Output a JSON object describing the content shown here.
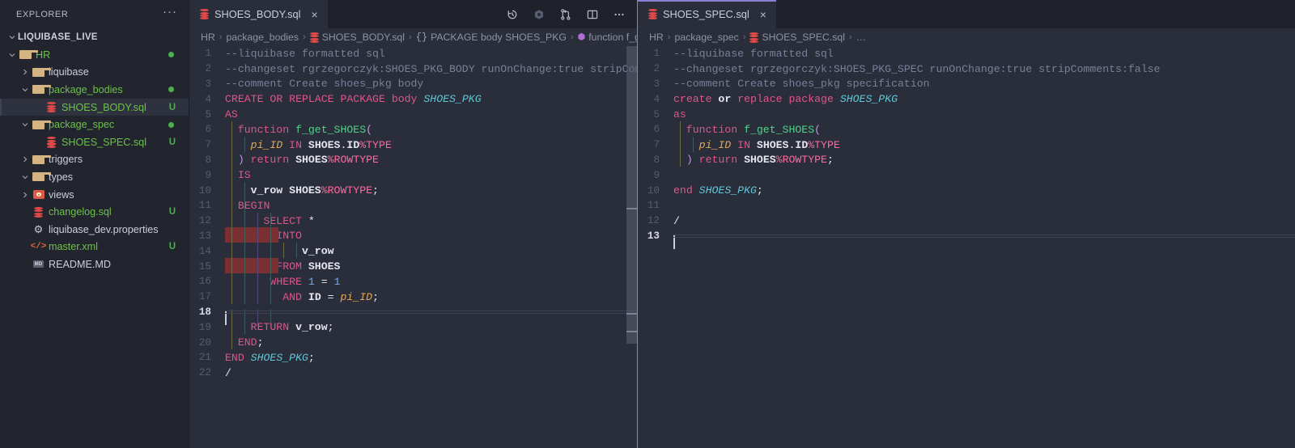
{
  "sidebar": {
    "title": "EXPLORER",
    "more_label": "···",
    "root": "LIQUIBASE_LIVE",
    "items": [
      {
        "label": "HR",
        "icon": "folder-icon",
        "indent": 1,
        "arrow": "down",
        "color": "green",
        "status": "dot",
        "selected": false
      },
      {
        "label": "liquibase",
        "icon": "folder-icon",
        "indent": 2,
        "arrow": "right",
        "color": "plain",
        "status": "",
        "selected": false
      },
      {
        "label": "package_bodies",
        "icon": "folder-icon",
        "indent": 2,
        "arrow": "down",
        "color": "green",
        "status": "dot",
        "selected": false
      },
      {
        "label": "SHOES_BODY.sql",
        "icon": "database-icon",
        "indent": 3,
        "arrow": "none",
        "color": "green",
        "status": "U",
        "selected": true
      },
      {
        "label": "package_spec",
        "icon": "folder-icon",
        "indent": 2,
        "arrow": "down",
        "color": "green",
        "status": "dot",
        "selected": false
      },
      {
        "label": "SHOES_SPEC.sql",
        "icon": "database-icon",
        "indent": 3,
        "arrow": "none",
        "color": "green",
        "status": "U",
        "selected": false
      },
      {
        "label": "triggers",
        "icon": "folder-icon",
        "indent": 2,
        "arrow": "right",
        "color": "plain",
        "status": "",
        "selected": false
      },
      {
        "label": "types",
        "icon": "folder-icon",
        "indent": 2,
        "arrow": "down",
        "color": "plain",
        "status": "",
        "selected": false
      },
      {
        "label": "views",
        "icon": "views-icon",
        "indent": 2,
        "arrow": "right",
        "color": "plain",
        "status": "",
        "selected": false
      },
      {
        "label": "changelog.sql",
        "icon": "database-icon",
        "indent": 2,
        "arrow": "none",
        "color": "green",
        "status": "U",
        "selected": false
      },
      {
        "label": "liquibase_dev.properties",
        "icon": "gear-icon",
        "indent": 2,
        "arrow": "none",
        "color": "plain",
        "status": "",
        "selected": false
      },
      {
        "label": "master.xml",
        "icon": "xml-icon",
        "indent": 2,
        "arrow": "none",
        "color": "green",
        "status": "U",
        "selected": false
      },
      {
        "label": "README.MD",
        "icon": "markdown-icon",
        "indent": 2,
        "arrow": "none",
        "color": "plain",
        "status": "",
        "selected": false
      }
    ]
  },
  "colors": {
    "accent_purple": "#8a7fd4",
    "git_modified_green": "#4caf50",
    "file_green": "#6cc24a",
    "db_icon_red": "#e24a4a",
    "folder_tan": "#d4b483",
    "editor_bg": "#2a2d3a",
    "sidebar_bg": "#22242e",
    "tabbar_bg": "#1f212b",
    "error_bar_red": "#7a2f33"
  },
  "editor_left": {
    "tab": {
      "label": "SHOES_BODY.sql",
      "icon": "database-icon",
      "close": "×",
      "active": false
    },
    "toolbar": [
      {
        "name": "history-icon",
        "title": "Timeline / History"
      },
      {
        "name": "refresh-icon",
        "title": "Refresh"
      },
      {
        "name": "source-control-icon",
        "title": "Source Control"
      },
      {
        "name": "split-editor-icon",
        "title": "Split Editor"
      },
      {
        "name": "more-actions-icon",
        "title": "More Actions…"
      }
    ],
    "breadcrumb": [
      {
        "label": "HR",
        "icon": "none"
      },
      {
        "label": "package_bodies",
        "icon": "none"
      },
      {
        "label": "SHOES_BODY.sql",
        "icon": "database-icon"
      },
      {
        "label": "PACKAGE body SHOES_PKG",
        "icon": "braces-icon"
      },
      {
        "label": "function f_g",
        "icon": "function-icon"
      }
    ],
    "cursor_line": 18,
    "lines": [
      {
        "n": 1,
        "text": "--liquibase formatted sql"
      },
      {
        "n": 2,
        "text": "--changeset rgrzegorczyk:SHOES_PKG_BODY runOnChange:true stripCom"
      },
      {
        "n": 3,
        "text": "--comment Create shoes_pkg body"
      },
      {
        "n": 4,
        "text": "CREATE OR REPLACE PACKAGE body SHOES_PKG"
      },
      {
        "n": 5,
        "text": "AS"
      },
      {
        "n": 6,
        "text": "  function f_get_SHOES("
      },
      {
        "n": 7,
        "text": "    pi_ID IN SHOES.ID%TYPE"
      },
      {
        "n": 8,
        "text": "  ) return SHOES%ROWTYPE"
      },
      {
        "n": 9,
        "text": "  IS"
      },
      {
        "n": 10,
        "text": "    v_row SHOES%ROWTYPE;"
      },
      {
        "n": 11,
        "text": "  BEGIN"
      },
      {
        "n": 12,
        "text": "      SELECT *"
      },
      {
        "n": 13,
        "text": "        INTO"
      },
      {
        "n": 14,
        "text": "            v_row"
      },
      {
        "n": 15,
        "text": "        FROM SHOES"
      },
      {
        "n": 16,
        "text": "       WHERE 1 = 1"
      },
      {
        "n": 17,
        "text": "         AND ID = pi_ID;"
      },
      {
        "n": 18,
        "text": ""
      },
      {
        "n": 19,
        "text": "    RETURN v_row;"
      },
      {
        "n": 20,
        "text": "  END;"
      },
      {
        "n": 21,
        "text": "END SHOES_PKG;"
      },
      {
        "n": 22,
        "text": "/"
      }
    ]
  },
  "editor_right": {
    "tab": {
      "label": "SHOES_SPEC.sql",
      "icon": "database-icon",
      "close": "×",
      "active": true
    },
    "breadcrumb": [
      {
        "label": "HR",
        "icon": "none"
      },
      {
        "label": "package_spec",
        "icon": "none"
      },
      {
        "label": "SHOES_SPEC.sql",
        "icon": "database-icon"
      },
      {
        "label": "…",
        "icon": "none"
      }
    ],
    "cursor_line": 13,
    "lines": [
      {
        "n": 1,
        "text": "--liquibase formatted sql"
      },
      {
        "n": 2,
        "text": "--changeset rgrzegorczyk:SHOES_PKG_SPEC runOnChange:true stripComments:false"
      },
      {
        "n": 3,
        "text": "--comment Create shoes_pkg specification"
      },
      {
        "n": 4,
        "text": "create or replace package SHOES_PKG"
      },
      {
        "n": 5,
        "text": "as"
      },
      {
        "n": 6,
        "text": "  function f_get_SHOES("
      },
      {
        "n": 7,
        "text": "    pi_ID IN SHOES.ID%TYPE"
      },
      {
        "n": 8,
        "text": "  ) return SHOES%ROWTYPE;"
      },
      {
        "n": 9,
        "text": ""
      },
      {
        "n": 10,
        "text": "end SHOES_PKG;"
      },
      {
        "n": 11,
        "text": ""
      },
      {
        "n": 12,
        "text": "/"
      },
      {
        "n": 13,
        "text": ""
      }
    ]
  }
}
